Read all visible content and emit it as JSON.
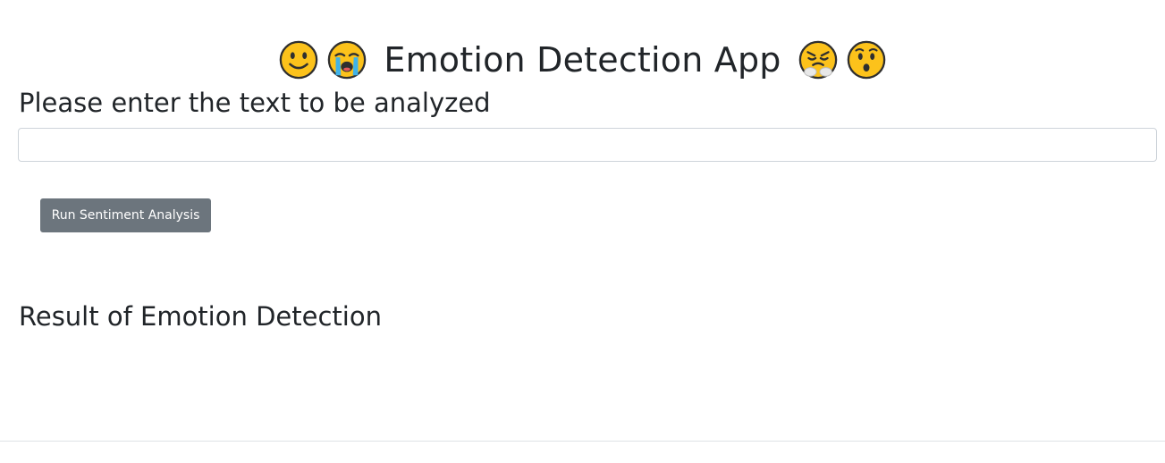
{
  "header": {
    "title": "Emotion Detection App",
    "emojis_left": [
      "slightly-smiling-face-icon",
      "loudly-crying-face-icon"
    ],
    "emojis_right": [
      "face-with-steam-icon",
      "hushed-face-icon"
    ]
  },
  "input_section": {
    "heading": "Please enter the text to be analyzed",
    "value": "",
    "placeholder": ""
  },
  "actions": {
    "run_label": "Run Sentiment Analysis"
  },
  "result_section": {
    "heading": "Result of Emotion Detection",
    "output": ""
  },
  "colors": {
    "text": "#212529",
    "button_bg": "#6c757d",
    "button_text": "#ffffff",
    "input_border": "#ced4da",
    "emoji_yellow": "#fcc21b",
    "divider": "#dee2e6"
  }
}
